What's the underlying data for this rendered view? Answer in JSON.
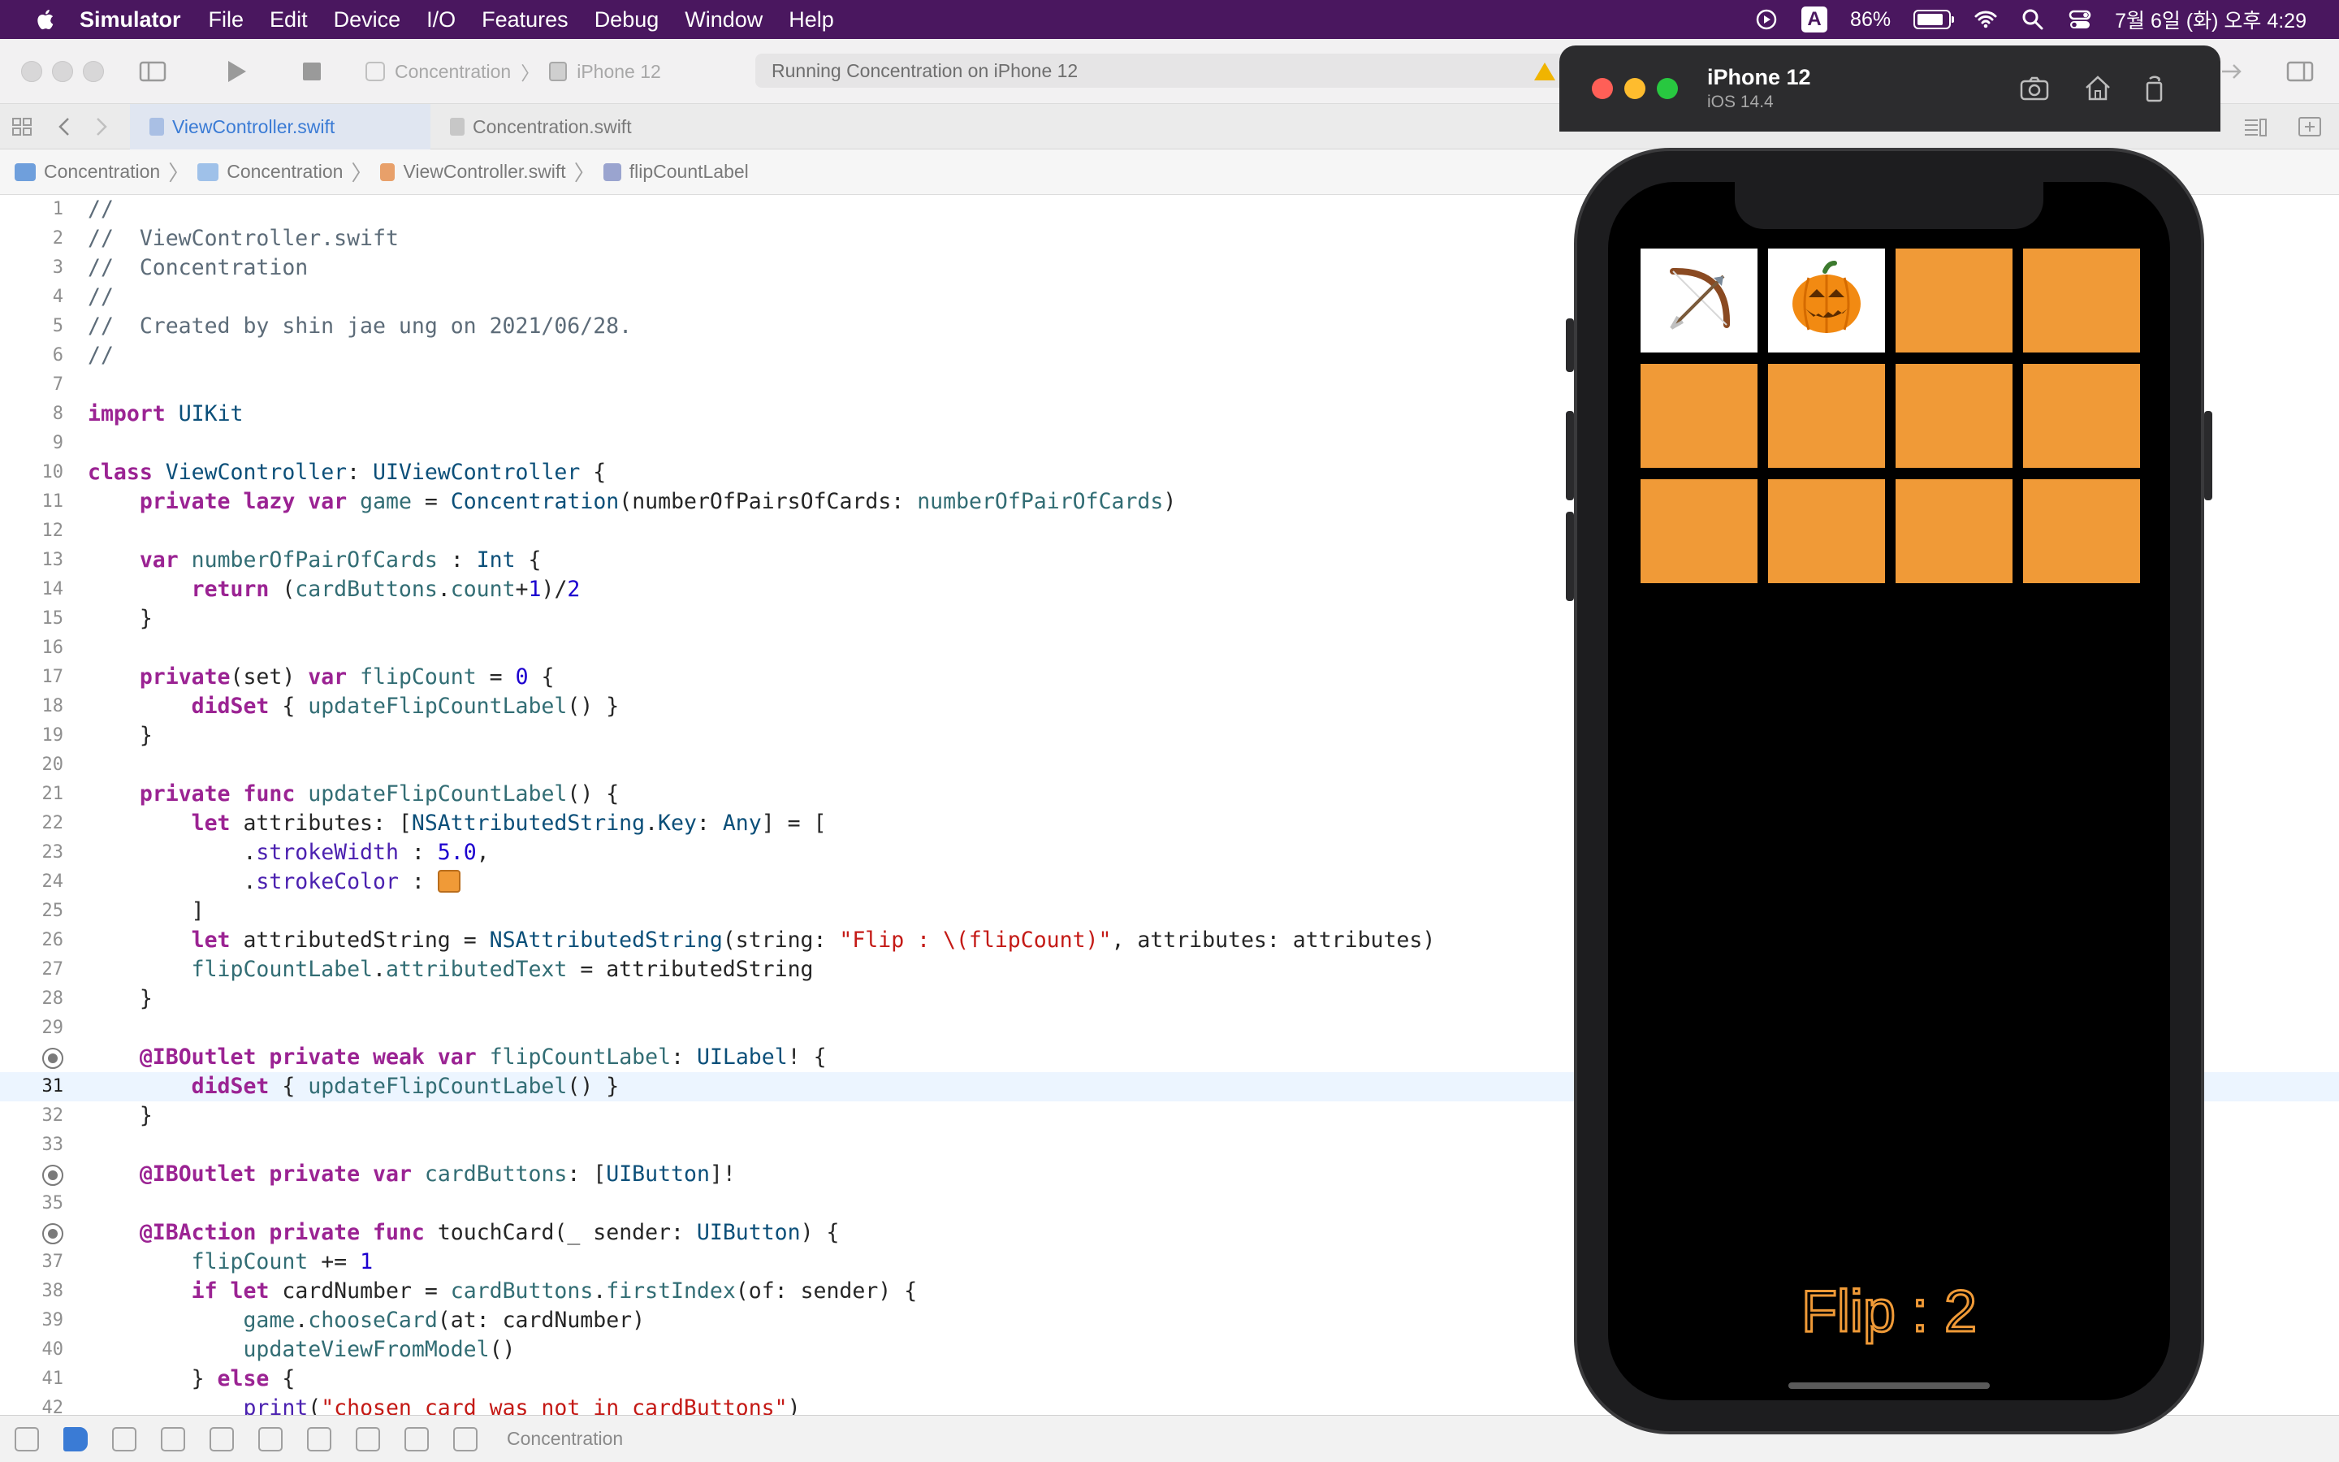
{
  "menubar": {
    "app_name": "Simulator",
    "items": [
      "File",
      "Edit",
      "Device",
      "I/O",
      "Features",
      "Debug",
      "Window",
      "Help"
    ],
    "input_indicator": "A",
    "battery_text": "86%",
    "battery_level": 0.86,
    "datetime": "7월 6일 (화) 오후 4:29"
  },
  "toolbar": {
    "scheme_name": "Concentration",
    "destination": "iPhone 12",
    "activity_text": "Running Concentration on iPhone 12"
  },
  "tabs": [
    {
      "label": "ViewController.swift",
      "active": true
    },
    {
      "label": "Concentration.swift",
      "active": false
    }
  ],
  "jumpbar": {
    "crumbs": [
      "Concentration",
      "Concentration",
      "ViewController.swift",
      "flipCountLabel"
    ]
  },
  "editor": {
    "current_line": 31,
    "lines": [
      {
        "n": "1",
        "code": "//"
      },
      {
        "n": "2",
        "code": "//  ViewController.swift"
      },
      {
        "n": "3",
        "code": "//  Concentration"
      },
      {
        "n": "4",
        "code": "//"
      },
      {
        "n": "5",
        "code": "//  Created by shin jae ung on 2021/06/28."
      },
      {
        "n": "6",
        "code": "//"
      },
      {
        "n": "7",
        "code": ""
      },
      {
        "n": "8",
        "code": "import UIKit"
      },
      {
        "n": "9",
        "code": ""
      },
      {
        "n": "10",
        "code": "class ViewController: UIViewController {"
      },
      {
        "n": "11",
        "code": "    private lazy var game = Concentration(numberOfPairsOfCards: numberOfPairOfCards)"
      },
      {
        "n": "12",
        "code": ""
      },
      {
        "n": "13",
        "code": "    var numberOfPairOfCards : Int {"
      },
      {
        "n": "14",
        "code": "        return (cardButtons.count+1)/2"
      },
      {
        "n": "15",
        "code": "    }"
      },
      {
        "n": "16",
        "code": ""
      },
      {
        "n": "17",
        "code": "    private(set) var flipCount = 0 {"
      },
      {
        "n": "18",
        "code": "        didSet { updateFlipCountLabel() }"
      },
      {
        "n": "19",
        "code": "    }"
      },
      {
        "n": "20",
        "code": ""
      },
      {
        "n": "21",
        "code": "    private func updateFlipCountLabel() {"
      },
      {
        "n": "22",
        "code": "        let attributes: [NSAttributedString.Key: Any] = ["
      },
      {
        "n": "23",
        "code": "            .strokeWidth : 5.0,"
      },
      {
        "n": "24",
        "code": "            .strokeColor : "
      },
      {
        "n": "25",
        "code": "        ]"
      },
      {
        "n": "26",
        "code": "        let attributedString = NSAttributedString(string: \"Flip : \\(flipCount)\", attributes: attributes)"
      },
      {
        "n": "27",
        "code": "        flipCountLabel.attributedText = attributedString"
      },
      {
        "n": "28",
        "code": "    }"
      },
      {
        "n": "29",
        "code": ""
      },
      {
        "n": "30",
        "code": "    @IBOutlet private weak var flipCountLabel: UILabel! {"
      },
      {
        "n": "31",
        "code": "        didSet { updateFlipCountLabel() }"
      },
      {
        "n": "32",
        "code": "    }"
      },
      {
        "n": "33",
        "code": ""
      },
      {
        "n": "34",
        "code": "    @IBOutlet private var cardButtons: [UIButton]!"
      },
      {
        "n": "35",
        "code": ""
      },
      {
        "n": "36",
        "code": "    @IBAction private func touchCard(_ sender: UIButton) {"
      },
      {
        "n": "37",
        "code": "        flipCount += 1"
      },
      {
        "n": "38",
        "code": "        if let cardNumber = cardButtons.firstIndex(of: sender) {"
      },
      {
        "n": "39",
        "code": "            game.chooseCard(at: cardNumber)"
      },
      {
        "n": "40",
        "code": "            updateViewFromModel()"
      },
      {
        "n": "41",
        "code": "        } else {"
      },
      {
        "n": "42",
        "code": "            print(\"chosen card was not in cardButtons\")"
      }
    ]
  },
  "debugbar": {
    "target": "Concentration"
  },
  "simulator": {
    "device_name": "iPhone 12",
    "os_version": "iOS 14.4",
    "flip_label": "Flip : 2",
    "card_color": "#f09a37",
    "cards": [
      {
        "face_up": true,
        "emoji": "bow-and-arrow"
      },
      {
        "face_up": true,
        "emoji": "jack-o-lantern"
      },
      {
        "face_up": false
      },
      {
        "face_up": false
      },
      {
        "face_up": false
      },
      {
        "face_up": false
      },
      {
        "face_up": false
      },
      {
        "face_up": false
      },
      {
        "face_up": false
      },
      {
        "face_up": false
      },
      {
        "face_up": false
      },
      {
        "face_up": false
      }
    ]
  }
}
